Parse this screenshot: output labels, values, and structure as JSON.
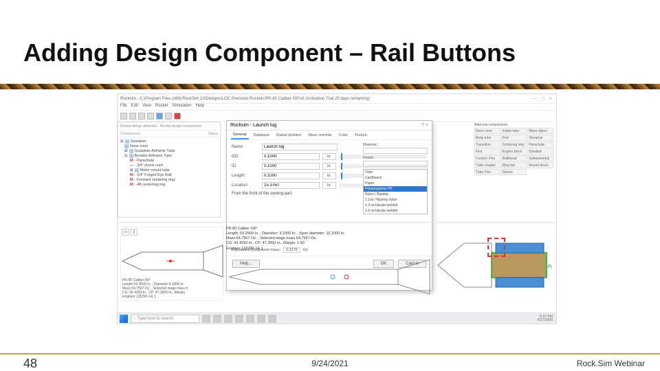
{
  "slide": {
    "title": "Adding Design Component – Rail Buttons",
    "number": "48",
    "date": "9/24/2021",
    "source": "Rock.Sim Webinar"
  },
  "app": {
    "window_title": "Rocksim - C:\\Program Files (x86)\\RockSim 10\\Designs\\LOC Precision Rockets\\PK-80 Caliber ISP.rkt  (Activation Trial 25 days remaining)",
    "menus": [
      "File",
      "Edit",
      "View",
      "Rocket",
      "Simulation",
      "Help"
    ],
    "win_controls": "— □ ×"
  },
  "tree": {
    "tab1": "Rocket design attributes",
    "tab2": "Rocket design components",
    "hdr_components": "Components",
    "hdr_status": "Status",
    "root": "Sustainer",
    "items": [
      "Nose cone",
      "Sustainer Airframe Tube",
      "Booster Airframe Tube",
      "Parachute",
      "3/4\" shock cord",
      "Motor mount tube",
      "1/4\" Forged Eye Bolt",
      "Forward centering ring",
      "Aft centering ring"
    ]
  },
  "palette": {
    "label": "Add new components",
    "items": [
      "Nose cone",
      "Inside tube",
      "Mass object",
      "Body tube",
      "Pod",
      "Streamer",
      "Transition",
      "Centering ring",
      "Parachute",
      "Fins",
      "Engine block",
      "Detailed",
      "Custom Fins",
      "Bulkhead",
      "Subassembly",
      "Tube coupler",
      "Ring tail",
      "Round block",
      "Tube Fins",
      "Sleeve"
    ]
  },
  "dialog": {
    "title": "Rocksim - Launch lug",
    "tabs": [
      "General",
      "Database",
      "Radial position",
      "Mass override",
      "Color",
      "Texture"
    ],
    "fields": {
      "name_label": "Name:",
      "name_value": "Launch lug",
      "od_label": "OD:",
      "od_value": "0.1000",
      "id_label": "ID:",
      "id_value": "0.1000",
      "len_label": "Length:",
      "len_value": "0.1000",
      "loc_label": "Location:",
      "loc_value": "15.3750",
      "loc_note": "From the front of the owning part.",
      "unit": "In."
    },
    "material": {
      "label": "Material:",
      "finish_label": "Finish:",
      "options": [
        "Tube",
        "Cardboard",
        "Paper",
        "Polypropylene PP",
        "Nylon / Ripstop",
        "1.1oz / Ripstop nylon",
        "1.3 oz tubular webbin",
        "1.9 oz tubular webbin"
      ],
      "selected": "Polypropylene PP"
    },
    "calc": {
      "label": "Calculated component mass:",
      "value": "0.3275",
      "unit": "Oz."
    },
    "buttons": {
      "help": "Help…",
      "ok": "OK",
      "cancel": "Cancel"
    }
  },
  "left_draw": {
    "text": "PK-80 Caliber ISP\nLength 59.2500 In. , Diameter 3.1000 In.\nMass 64.7567 Oz. , Selected stage mass 6\nCG: 42.4293 In., CP: 47.3950 In., Margin\nEngines: [J315R-14, ]"
  },
  "mid_draw": {
    "text": "PK-80 Caliber ISP\nLength: 59.2500 In. , Diameter: 3.1000 In. , Span diameter: 10.1000 In.\nMass 64.7567 Oz. , Selected stage mass 64.7567 Oz.\nCG: 42.4293 In., CP: 47.3950 In., Margin: 1.60\nEngines: [J315R-14, ]"
  },
  "taskbar": {
    "search_placeholder": "Type here to search",
    "time": "6:37 PM",
    "date": "8/17/2020"
  }
}
